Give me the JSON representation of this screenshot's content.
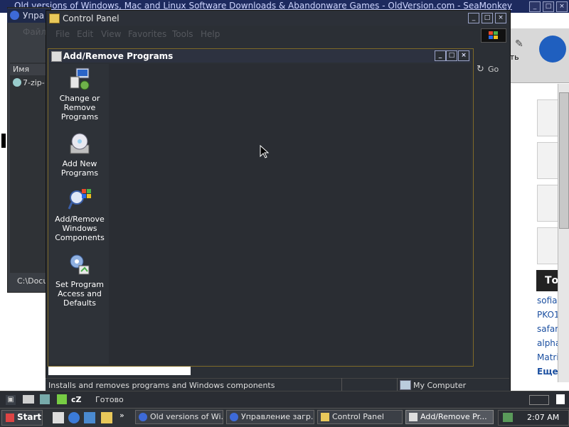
{
  "seamonkey": {
    "title": "Old versions of Windows, Mac and Linux Software Downloads & Abandonware Games - OldVersion.com - SeaMonkey",
    "toolbar_text": "ать",
    "sidebar_heading": "То",
    "links": [
      "sofiar",
      "PKO1",
      "safar",
      "alpha",
      "Matrix",
      "Еще п"
    ]
  },
  "download_manager": {
    "title": "Упра",
    "menu": "Файл",
    "column_header": "Имя",
    "row_item": "7-zip-",
    "path": "C:\\Docu"
  },
  "control_panel": {
    "title": "Control Panel",
    "menu": [
      "File",
      "Edit",
      "View",
      "Favorites",
      "Tools",
      "Help"
    ],
    "go_label": "Go",
    "status_left": "Installs and removes programs and Windows components",
    "status_right": "My Computer"
  },
  "add_remove": {
    "title": "Add/Remove Programs",
    "items": [
      {
        "label": "Change or Remove Programs",
        "icon": "change-remove-programs-icon"
      },
      {
        "label": "Add New Programs",
        "icon": "add-new-programs-icon"
      },
      {
        "label": "Add/Remove Windows Components",
        "icon": "windows-components-icon"
      },
      {
        "label": "Set Program Access and Defaults",
        "icon": "program-defaults-icon"
      }
    ]
  },
  "browser_status": {
    "text": "Готово",
    "quick_label": "cZ"
  },
  "taskbar": {
    "start": "Start",
    "tasks": [
      {
        "label": "Old versions of Wi...",
        "active": false
      },
      {
        "label": "Управление загр...",
        "active": false
      },
      {
        "label": "Control Panel",
        "active": false
      },
      {
        "label": "Add/Remove Pr...",
        "active": true
      }
    ],
    "clock": "2:07 AM"
  },
  "colors": {
    "window_bg": "#2b2f35",
    "accent_border": "#7f6a28",
    "taskbar_bg": "#2f3338"
  }
}
